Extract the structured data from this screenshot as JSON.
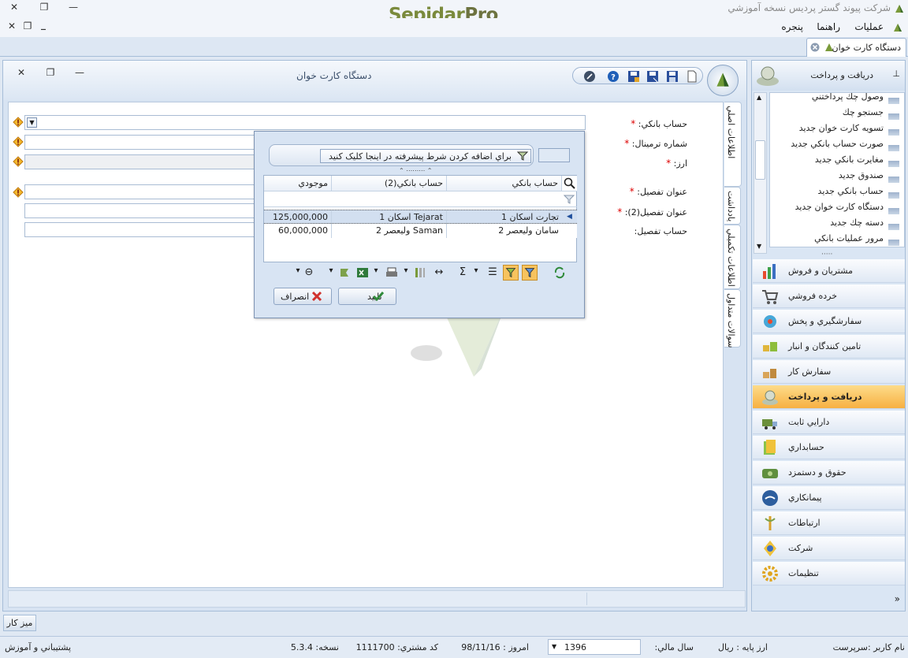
{
  "window": {
    "title": "شرکت پیوند گستر پردیس نسخه آموزشي",
    "brand_part1": "Sepidar",
    "brand_part2": "Pro",
    "close_glyph": "✕",
    "restore_glyph": "❐",
    "minimize_glyph": "—"
  },
  "menubar": {
    "items": [
      "عمليات",
      "راهنما",
      "پنجره"
    ],
    "close_glyph": "✕",
    "restore_glyph": "❐",
    "minimize_glyph": "_"
  },
  "doc_tabs": [
    {
      "label": "دستگاه کارت خوان"
    }
  ],
  "form": {
    "title": "دستگاه کارت خوان",
    "fields": {
      "bank_account": "حساب بانکي:",
      "terminal_no": "شماره ترمينال:",
      "currency": "ارز:",
      "detail_title": "عنوان تفصيل:",
      "detail_title2": "عنوان تفصيل(2):",
      "detail_account": "حساب تفصيل:"
    },
    "required_mark": "*",
    "side_tabs": [
      "اطلاعات اصلي",
      "يادداشت",
      "اطلاعات تکميلي",
      "سوالات متداول"
    ]
  },
  "lookup": {
    "filter_hint": "براي اضافه کردن شرط پيشرفته در اينجا کليک کنيد",
    "columns": [
      "حساب بانکي",
      "حساب بانکي(2)",
      "موجودي"
    ],
    "rows": [
      {
        "bank_account": "تجارت اسکان 1",
        "bank_account2": "Tejarat اسکان 1",
        "balance": "125,000,000"
      },
      {
        "bank_account": "سامان وليعصر 2",
        "bank_account2": "Saman وليعصر 2",
        "balance": "60,000,000"
      }
    ],
    "ok_label": "تاييد",
    "cancel_label": "انصراف"
  },
  "nav": {
    "header": "دريافت و پرداخت",
    "sub_items": [
      "وصول چك پرداختني",
      "جستجو چك",
      "تسويه كارت خوان جديد",
      "صورت حساب بانكي جديد",
      "مغايرت بانکي جديد",
      "صندوق جديد",
      "حساب بانکي جديد",
      "دستگاه کارت خوان جديد",
      "دسته چك جديد",
      "مرور عمليات بانكي"
    ],
    "modules": [
      "مشتريان و فروش",
      "خرده فروشي",
      "سفارشگيري و پخش",
      "تامين کنندگان و انبار",
      "سفارش کار",
      "دريافت و پرداخت",
      "دارايي ثابت",
      "حسابداري",
      "حقوق و دستمزد",
      "پيمانکاري",
      "ارتباطات",
      "شرکت",
      "تنظيمات"
    ],
    "selected_module": "دريافت و پرداخت",
    "chevron_glyph": "»"
  },
  "desktop_tab": "ميز کار",
  "status": {
    "user_label": "نام کاربر :",
    "user_value": "سرپرست",
    "base_currency_label": "ارز پايه :",
    "base_currency_value": "ريال",
    "fiscal_year_label": "سال مالي:",
    "fiscal_year_value": "1396",
    "today_label": "امروز :",
    "today_value": "98/11/16",
    "customer_code_label": "کد مشتري:",
    "customer_code_value": "1111700",
    "version_label": "نسخه:",
    "version_value": "5.3.4",
    "support_link": "پشتيباني و آموزش"
  },
  "colors": {
    "accent": "#f7b042",
    "selected_row": "#d2dff0",
    "required": "#dd0000"
  }
}
